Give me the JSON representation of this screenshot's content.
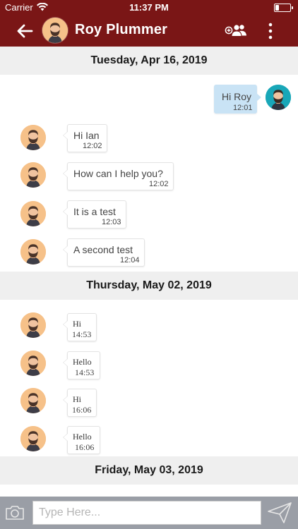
{
  "status_bar": {
    "carrier": "Carrier",
    "time": "11:37 PM"
  },
  "header": {
    "contact_name": "Roy Plummer",
    "icons": [
      "back-arrow-icon",
      "add-group-icon",
      "more-vertical-icon"
    ]
  },
  "chat": {
    "sections": [
      {
        "date": "Tuesday, Apr 16, 2019",
        "messages": [
          {
            "direction": "out",
            "text": "Hi Roy",
            "time": "12:01"
          },
          {
            "direction": "in",
            "text": "Hi Ian",
            "time": "12:02"
          },
          {
            "direction": "in",
            "text": "How can I help you?",
            "time": "12:02"
          },
          {
            "direction": "in",
            "text": "It is a test",
            "time": "12:03"
          },
          {
            "direction": "in",
            "text": "A second test",
            "time": "12:04"
          }
        ]
      },
      {
        "date": "Thursday, May 02, 2019",
        "messages": [
          {
            "direction": "in",
            "text": "Hi",
            "time": "14:53"
          },
          {
            "direction": "in",
            "text": "Hello",
            "time": "14:53"
          },
          {
            "direction": "in",
            "text": "Hi",
            "time": "16:06"
          },
          {
            "direction": "in",
            "text": "Hello",
            "time": "16:06"
          }
        ]
      },
      {
        "date": "Friday, May 03, 2019",
        "messages": []
      }
    ]
  },
  "input_bar": {
    "placeholder": "Type Here...",
    "value": ""
  },
  "colors": {
    "header_bg": "#7a1616",
    "date_separator_bg": "#efefef",
    "outgoing_bubble": "#c9e3f5",
    "incoming_bubble": "#ffffff",
    "input_bar_bg": "#9a9ea6"
  }
}
